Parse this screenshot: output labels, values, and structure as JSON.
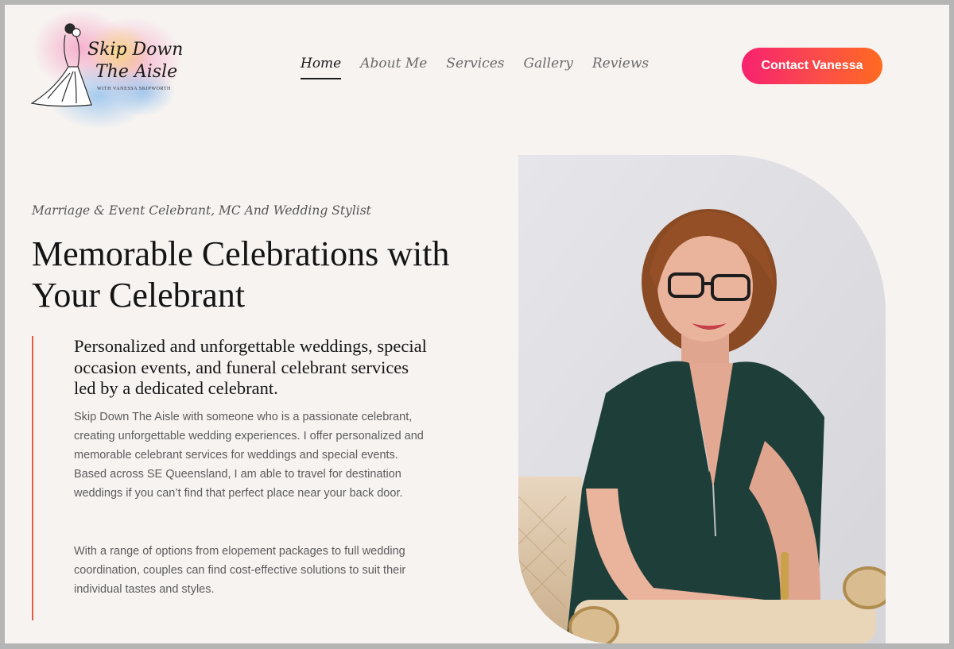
{
  "header": {
    "logo": {
      "line1": "Skip Down",
      "line2": "The Aisle",
      "tagline": "WITH VANESSA SKIPWORTH"
    },
    "nav": [
      {
        "label": "Home",
        "active": true
      },
      {
        "label": "About Me"
      },
      {
        "label": "Services"
      },
      {
        "label": "Gallery"
      },
      {
        "label": "Reviews"
      }
    ],
    "cta_label": "Contact Vanessa"
  },
  "hero": {
    "eyebrow": "Marriage & Event Celebrant, MC And Wedding Stylist",
    "headline": "Memorable Celebrations with Your Celebrant",
    "lead": "Personalized and unforgettable weddings, special occasion events, and funeral celebrant services led by a dedicated celebrant.",
    "paragraphs": [
      "Skip Down The Aisle with someone who is a passionate celebrant, creating unforgettable wedding experiences. I offer personalized and memorable celebrant services for weddings and special events. Based across SE Queensland, I am able to travel for destination weddings if you can’t find that perfect place near your back door.",
      "With a range of options from elopement packages to full wedding coordination, couples can find cost-effective solutions to suit their individual tastes and styles."
    ]
  },
  "colors": {
    "background": "#f7f3f1",
    "accent_line": "#e05a45",
    "cta_gradient_start": "#f7226f",
    "cta_gradient_end": "#ff6a1f"
  }
}
